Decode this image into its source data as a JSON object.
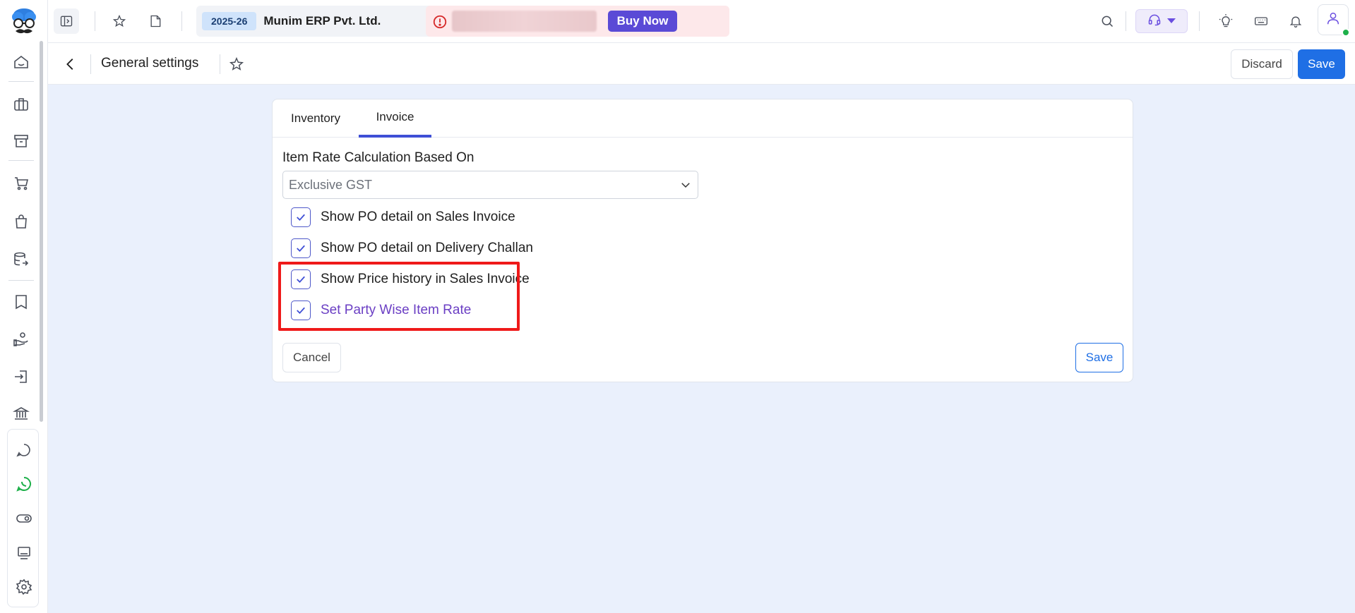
{
  "topbar": {
    "financial_year": "2025-26",
    "company_name": "Munim ERP Pvt. Ltd.",
    "buy_now_label": "Buy Now"
  },
  "page_header": {
    "title": "General settings",
    "discard_label": "Discard",
    "save_label": "Save"
  },
  "tabs": [
    {
      "label": "Inventory",
      "active": false
    },
    {
      "label": "Invoice",
      "active": true
    }
  ],
  "form": {
    "rate_calc_label": "Item Rate Calculation Based On",
    "rate_calc_value": "Exclusive GST",
    "options": [
      {
        "label": "Show PO detail on Sales Invoice",
        "checked": true
      },
      {
        "label": "Show PO detail on Delivery Challan",
        "checked": true
      },
      {
        "label": "Show Price history in Sales Invoice",
        "checked": true
      },
      {
        "label": "Set Party Wise Item Rate",
        "checked": true
      }
    ],
    "cancel_label": "Cancel",
    "save_label": "Save"
  },
  "colors": {
    "accent": "#3f4fd6",
    "primary_button": "#1f6fe5",
    "buy_now": "#5a4ad6",
    "highlight": "#ef1a1a",
    "online": "#1eb04a",
    "background": "#eaf0fc"
  },
  "icons": {
    "sidebar": [
      "home-icon",
      "briefcase-icon",
      "archive-icon",
      "cart-icon",
      "shopping-bag-icon",
      "database-export-icon",
      "receipt-icon",
      "hand-coins-icon",
      "login-icon",
      "bank-icon",
      "chat-icon",
      "whatsapp-icon",
      "toggle-icon",
      "monitor-icon",
      "gear-icon"
    ],
    "topbar": [
      "sidebar-toggle-icon",
      "star-icon",
      "note-icon",
      "chevron-down-icon",
      "alert-circle-icon",
      "search-icon",
      "headset-icon",
      "lightbulb-icon",
      "keyboard-icon",
      "bell-icon",
      "user-icon"
    ]
  }
}
